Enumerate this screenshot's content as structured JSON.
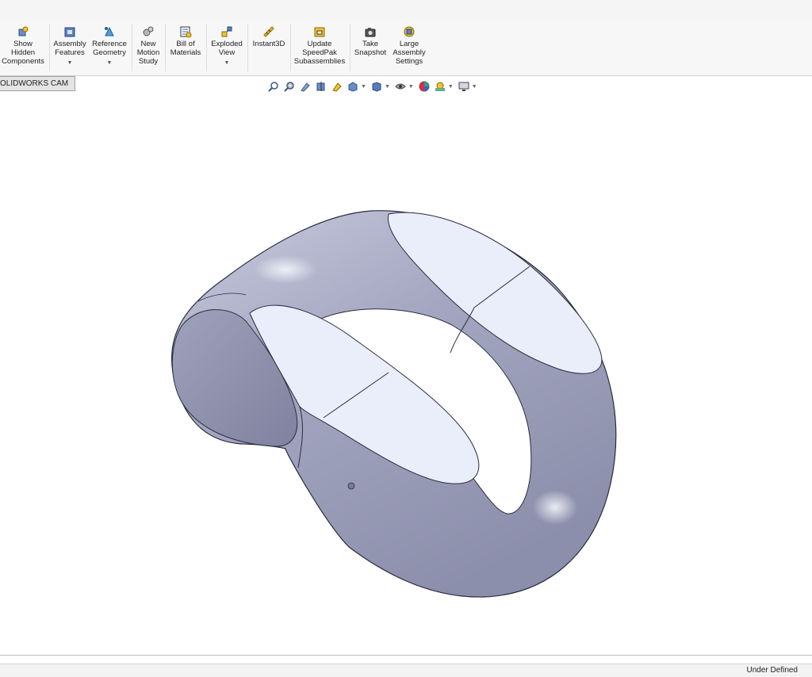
{
  "ribbon": {
    "show_hidden": "Show\nHidden\nComponents",
    "assembly_features": "Assembly\nFeatures",
    "reference_geometry": "Reference\nGeometry",
    "new_motion_study": "New\nMotion\nStudy",
    "bill_of_materials": "Bill of\nMaterials",
    "exploded_view": "Exploded\nView",
    "instant3d": "Instant3D",
    "update_speedpak": "Update\nSpeedPak\nSubassemblies",
    "take_snapshot": "Take\nSnapshot",
    "large_assembly": "Large\nAssembly\nSettings"
  },
  "tabs": {
    "solidworks_cam": "OLIDWORKS CAM"
  },
  "heads_up_toolbar": {
    "icons": [
      "zoom-to-fit-icon",
      "zoom-to-area-icon",
      "previous-view-icon",
      "section-view-icon",
      "dynamic-annotation-icon",
      "view-orientation-icon",
      "display-style-icon",
      "hide-show-items-icon",
      "edit-appearance-icon",
      "apply-scene-icon",
      "view-settings-icon"
    ]
  },
  "status": {
    "text": "Under Defined"
  },
  "colors": {
    "model_body": "#a6a9c4",
    "model_flat_face": "#eaeefa",
    "ribbon_bg": "#f7f7f7"
  }
}
